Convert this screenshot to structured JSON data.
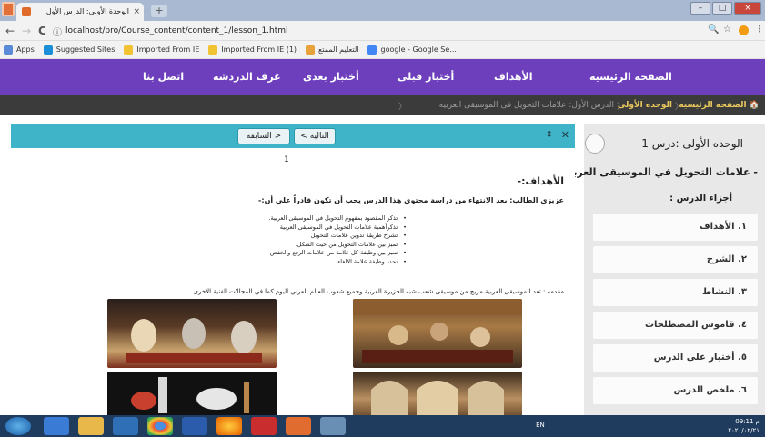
{
  "browser": {
    "tab_title": "الوحدة الأولى: الدرس الأول",
    "tab_close": "×",
    "new_tab": "+",
    "back": "←",
    "forward": "→",
    "reload": "C",
    "url": "localhost/pro/Course_content/content_1/lesson_1.html",
    "info_icon": "ⓘ",
    "zoom_icon": "🔍",
    "star_icon": "☆",
    "menu_icon": "⋮",
    "win_min": "–",
    "win_max": "□",
    "win_close": "×"
  },
  "bookmarks": [
    {
      "label": "Apps",
      "icon": "apps-icon",
      "color": "#5b8bd6"
    },
    {
      "label": "Suggested Sites",
      "icon": "bing-icon",
      "color": "#1a8fd8"
    },
    {
      "label": "Imported From IE",
      "icon": "folder-icon",
      "color": "#f1c232"
    },
    {
      "label": "Imported From IE (1)",
      "icon": "folder-icon",
      "color": "#f1c232"
    },
    {
      "label": "التعليم الممتع",
      "icon": "globe-icon",
      "color": "#e8a23a"
    },
    {
      "label": "google - Google Se...",
      "icon": "google-icon",
      "color": "#4285f4"
    }
  ],
  "nav": {
    "home": "الصفحه الرئيسيه",
    "goals": "الأهداف",
    "pretest": "أختبار قبلى",
    "posttest": "أختبار بعدى",
    "chat": "غرف الدردشه",
    "contact": "اتصل بنا"
  },
  "breadcrumb": {
    "home_icon": "🏠",
    "home": "الصفحه الرئيسيه",
    "unit": "الوحده الأولى",
    "lesson": "الدرس الأول: علامات التحويل فى الموسيقى العربيه",
    "sep": "〈"
  },
  "sidebar": {
    "title": "الوحده الأولى :درس 1",
    "subtitle": "- علامات التحويل في الموسيقى العربية",
    "parts_label": "أجزاء الدرس :",
    "items": [
      "١. الأهداف",
      "٢. الشرح",
      "٣. النشاط",
      "٤. قاموس المصطلحات",
      "٥. أختبار على الدرس",
      "٦. ملخص الدرس"
    ]
  },
  "content": {
    "prev": "< السابقه",
    "next": "التاليه >",
    "expand_icon": "⇕",
    "close_icon": "✕",
    "page_number": "1",
    "goals_title": "الأهداف:-",
    "intro": "عزيزي الطالب: بعد الانتهاء من دراسة محتوي هذا الدرس يجب أن تكون قادراً علي أن:-",
    "bullets": [
      "تذكر المقصود بمفهوم التحويل في الموسيقى العربية.",
      "تذكرأهمية علامات التحويل في الموسيقى العربية",
      "تشرح طريقة تدوين علامات التحويل",
      "تميز بين علامات التحويل من حيث الشكل.",
      "تميز بين وظيفة كل علامة من علامات الرفع والخفض",
      "تحدد وظيفة علامة الالغاء"
    ],
    "prelude": "مقدمه : تعد الموسيقى العربية مزيج من موسيقى شعب شبه الجزيرة العربية وجميع شعوب العالم العربي اليوم كما في المجالات الفنية الأخرى ."
  },
  "taskbar": {
    "lang": "EN",
    "time": "09:11 م",
    "date": "٢٠٢٠/٠٢/٢١"
  },
  "colors": {
    "nav": "#6d3fbd",
    "accent": "#3fb3c8",
    "crumb": "#e8c75c"
  }
}
